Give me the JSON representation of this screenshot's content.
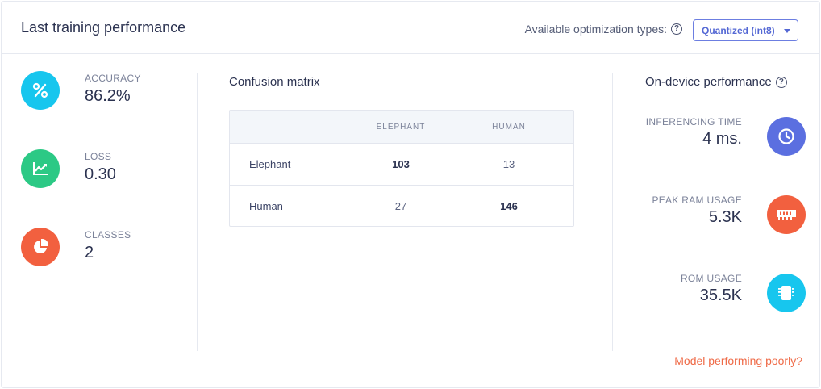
{
  "header": {
    "title": "Last training performance",
    "optimization_label": "Available optimization types:",
    "optimization_value": "Quantized (int8)"
  },
  "metrics": [
    {
      "label": "ACCURACY",
      "value": "86.2%",
      "icon": "percent-icon",
      "color": "#17c6ee"
    },
    {
      "label": "LOSS",
      "value": "0.30",
      "icon": "chart-trend-icon",
      "color": "#2cc985"
    },
    {
      "label": "CLASSES",
      "value": "2",
      "icon": "pie-chart-icon",
      "color": "#f2603f"
    }
  ],
  "confusion_matrix": {
    "title": "Confusion matrix",
    "columns": [
      "ELEPHANT",
      "HUMAN"
    ],
    "rows": [
      {
        "label": "Elephant",
        "values": [
          "103",
          "13"
        ]
      },
      {
        "label": "Human",
        "values": [
          "27",
          "146"
        ]
      }
    ]
  },
  "on_device": {
    "title": "On-device performance",
    "items": [
      {
        "label": "INFERENCING TIME",
        "value": "4 ms.",
        "icon": "clock-icon",
        "color": "#5b6fe0"
      },
      {
        "label": "PEAK RAM USAGE",
        "value": "5.3K",
        "icon": "ram-icon",
        "color": "#f2603f"
      },
      {
        "label": "ROM USAGE",
        "value": "35.5K",
        "icon": "chip-icon",
        "color": "#17c6ee"
      }
    ]
  },
  "footer": {
    "link": "Model performing poorly?"
  }
}
